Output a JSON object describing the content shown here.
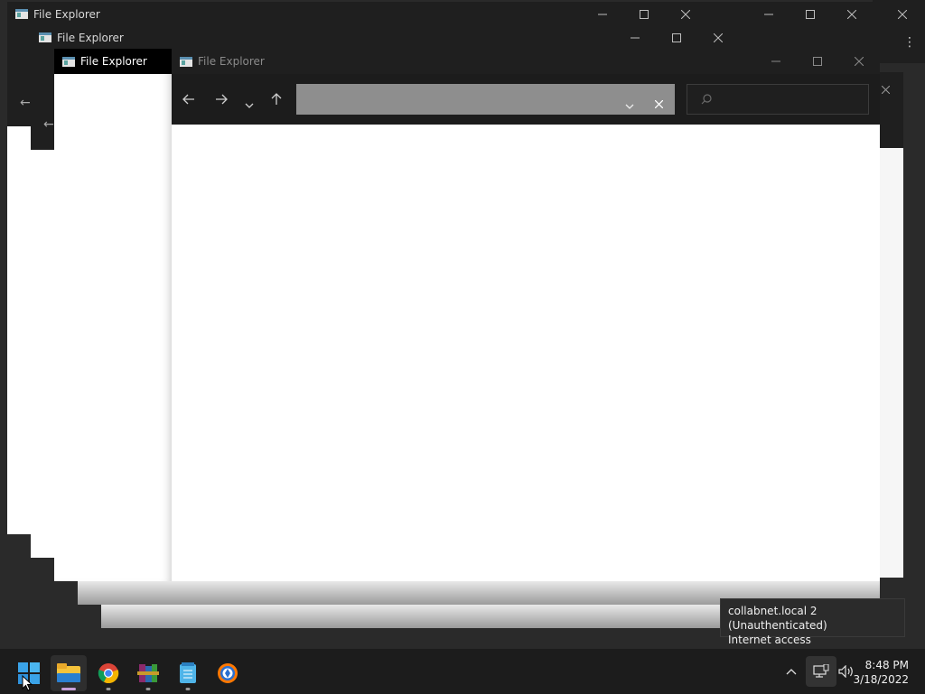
{
  "windows": {
    "w1_title": "File Explorer",
    "w2_title": "File Explorer",
    "w3_title": "File Explorer",
    "main_title": "File Explorer",
    "main_tab_title": "File Explorer"
  },
  "address": {
    "value": "",
    "placeholder": ""
  },
  "search": {
    "value": "",
    "placeholder": ""
  },
  "tooltip": {
    "line1": "collabnet.local 2 (Unauthenticated)",
    "line2": "Internet access"
  },
  "clock": {
    "time": "8:48 PM",
    "date": "3/18/2022"
  },
  "taskbar": {
    "apps": [
      "start-icon",
      "file-explorer-icon",
      "chrome-icon",
      "winrar-icon",
      "notepad-icon",
      "avast-icon"
    ]
  },
  "colors": {
    "accent": "#0078d4",
    "chrome": "#1f1f1f",
    "titlebar_active": "#000000"
  }
}
